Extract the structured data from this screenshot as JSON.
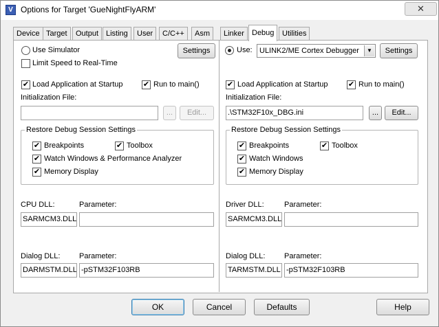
{
  "window": {
    "title": "Options for Target 'GueNightFlyARM'",
    "close_glyph": "✕",
    "app_icon_glyph": "V"
  },
  "tabs": [
    "Device",
    "Target",
    "Output",
    "Listing",
    "User",
    "C/C++",
    "Asm",
    "Linker",
    "Debug",
    "Utilities"
  ],
  "active_tab": "Debug",
  "left": {
    "use_simulator_label": "Use Simulator",
    "use_simulator_selected": false,
    "settings_label": "Settings",
    "limit_speed_label": "Limit Speed to Real-Time",
    "limit_speed_checked": false,
    "load_app_label": "Load Application at Startup",
    "load_app_checked": true,
    "run_to_main_label": "Run to main()",
    "run_to_main_checked": true,
    "init_file_label": "Initialization File:",
    "init_file_value": "",
    "browse_label": "...",
    "edit_label": "Edit...",
    "restore_group_title": "Restore Debug Session Settings",
    "breakpoints_label": "Breakpoints",
    "toolbox_label": "Toolbox",
    "watch_label": "Watch Windows & Performance Analyzer",
    "memory_label": "Memory Display",
    "cpu_dll_label": "CPU DLL:",
    "cpu_param_label": "Parameter:",
    "cpu_dll_value": "SARMCM3.DLL",
    "cpu_param_value": "",
    "dialog_dll_label": "Dialog DLL:",
    "dialog_param_label": "Parameter:",
    "dialog_dll_value": "DARMSTM.DLL",
    "dialog_param_value": "-pSTM32F103RB"
  },
  "right": {
    "use_label": "Use:",
    "use_selected": true,
    "debugger_value": "ULINK2/ME Cortex Debugger",
    "settings_label": "Settings",
    "load_app_label": "Load Application at Startup",
    "load_app_checked": true,
    "run_to_main_label": "Run to main()",
    "run_to_main_checked": true,
    "init_file_label": "Initialization File:",
    "init_file_value": ".\\STM32F10x_DBG.ini",
    "browse_label": "...",
    "edit_label": "Edit...",
    "restore_group_title": "Restore Debug Session Settings",
    "breakpoints_label": "Breakpoints",
    "toolbox_label": "Toolbox",
    "watch_label": "Watch Windows",
    "memory_label": "Memory Display",
    "driver_dll_label": "Driver DLL:",
    "driver_param_label": "Parameter:",
    "driver_dll_value": "SARMCM3.DLL",
    "driver_param_value": "",
    "dialog_dll_label": "Dialog DLL:",
    "dialog_param_label": "Parameter:",
    "dialog_dll_value": "TARMSTM.DLL",
    "dialog_param_value": "-pSTM32F103RB"
  },
  "footer": {
    "ok": "OK",
    "cancel": "Cancel",
    "defaults": "Defaults",
    "help": "Help"
  },
  "check_glyph": "✔",
  "arrow_glyph": "▼"
}
